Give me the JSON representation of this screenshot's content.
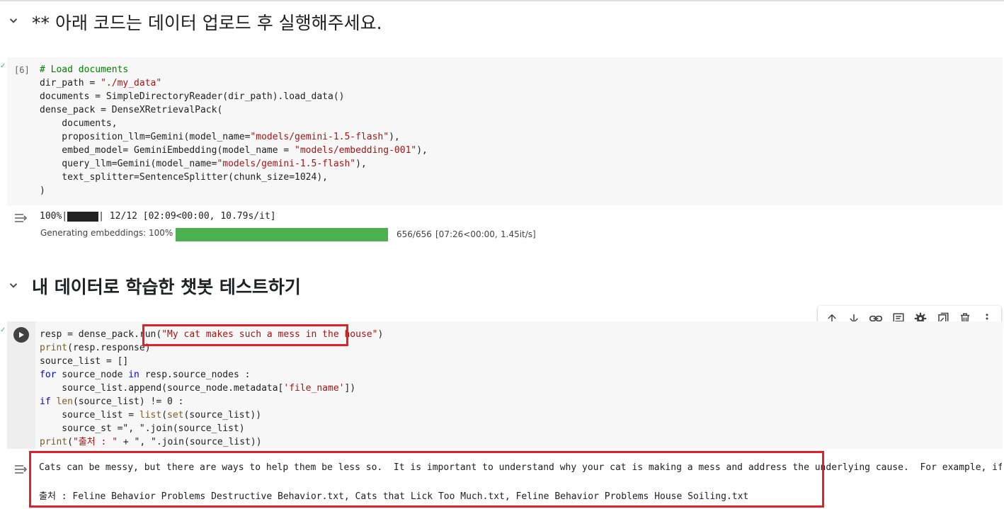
{
  "section1": {
    "title": "** 아래 코드는 데이터 업로드 후 실행해주세요."
  },
  "cell1": {
    "exec_count": "[6]",
    "code_lines": [
      [
        {
          "t": "# Load documents",
          "c": "c"
        }
      ],
      [
        {
          "t": "dir_path = "
        },
        {
          "t": "\"./my_data\"",
          "c": "s"
        }
      ],
      [
        {
          "t": "documents = SimpleDirectoryReader(dir_path).load_data()"
        }
      ],
      [
        {
          "t": "dense_pack = DenseXRetrievalPack("
        }
      ],
      [
        {
          "t": "    documents,"
        }
      ],
      [
        {
          "t": "    proposition_llm=Gemini(model_name="
        },
        {
          "t": "\"models/gemini-1.5-flash\"",
          "c": "s"
        },
        {
          "t": "),"
        }
      ],
      [
        {
          "t": "    embed_model= GeminiEmbedding(model_name = "
        },
        {
          "t": "\"models/embedding-001\"",
          "c": "s"
        },
        {
          "t": "),"
        }
      ],
      [
        {
          "t": "    query_llm=Gemini(model_name="
        },
        {
          "t": "\"models/gemini-1.5-flash\"",
          "c": "s"
        },
        {
          "t": "),"
        }
      ],
      [
        {
          "t": "    text_splitter=SentenceSplitter(chunk_size=1024),"
        }
      ],
      [
        {
          "t": ")"
        }
      ]
    ],
    "output": {
      "progress1_prefix": "100%|",
      "progress1_suffix": "| 12/12 [02:09<00:00, 10.79s/it]",
      "progress2_label": "Generating embeddings: 100%",
      "progress2_fraction": 1.0,
      "progress2_counts": "656/656",
      "progress2_time": "[07:26<00:00,",
      "progress2_rate": "1.45it/s]"
    }
  },
  "section2": {
    "title": "내 데이터로 학습한 챗봇 테스트하기"
  },
  "cell2": {
    "code_lines": [
      [
        {
          "t": "resp = dense_pack.run("
        },
        {
          "t": "\"My cat makes such a mess in the house\"",
          "c": "s"
        },
        {
          "t": ")"
        }
      ],
      [
        {
          "t": "print",
          "c": "b"
        },
        {
          "t": "(resp.response)"
        }
      ],
      [
        {
          "t": "source_list = []"
        }
      ],
      [
        {
          "t": "for",
          "c": "k"
        },
        {
          "t": " source_node "
        },
        {
          "t": "in",
          "c": "k"
        },
        {
          "t": " resp.source_nodes :"
        }
      ],
      [
        {
          "t": "    source_list.append(source_node.metadata["
        },
        {
          "t": "'file_name'",
          "c": "s"
        },
        {
          "t": "])"
        }
      ],
      [
        {
          "t": "if",
          "c": "k"
        },
        {
          "t": " "
        },
        {
          "t": "len",
          "c": "b"
        },
        {
          "t": "(source_list) != 0 :"
        }
      ],
      [
        {
          "t": "    source_list = "
        },
        {
          "t": "list",
          "c": "b"
        },
        {
          "t": "("
        },
        {
          "t": "set",
          "c": "b"
        },
        {
          "t": "(source_list))"
        }
      ],
      [
        {
          "t": "    source_st =\", \".join(source_list)"
        }
      ],
      [
        {
          "t": "print",
          "c": "b"
        },
        {
          "t": "("
        },
        {
          "t": "\"출처 : \"",
          "c": "s"
        },
        {
          "t": " + \", \".join(source_list))"
        }
      ]
    ],
    "output_line1": "Cats can be messy, but there are ways to help them be less so.  It is important to understand why your cat is making a mess and address the underlying cause.  For example, if your cat is sprayin",
    "output_line2": "출처 : Feline Behavior Problems Destructive Behavior.txt, Cats that Lick Too Much.txt, Feline Behavior Problems House Soiling.txt"
  },
  "toolbar": {
    "buttons": [
      "move-up-icon",
      "move-down-icon",
      "link-icon",
      "comment-icon",
      "settings-icon",
      "mirror-cell-icon",
      "delete-icon",
      "more-icon"
    ]
  },
  "colors": {
    "accent_red": "#e0212a",
    "progress_green": "#4caf50"
  }
}
